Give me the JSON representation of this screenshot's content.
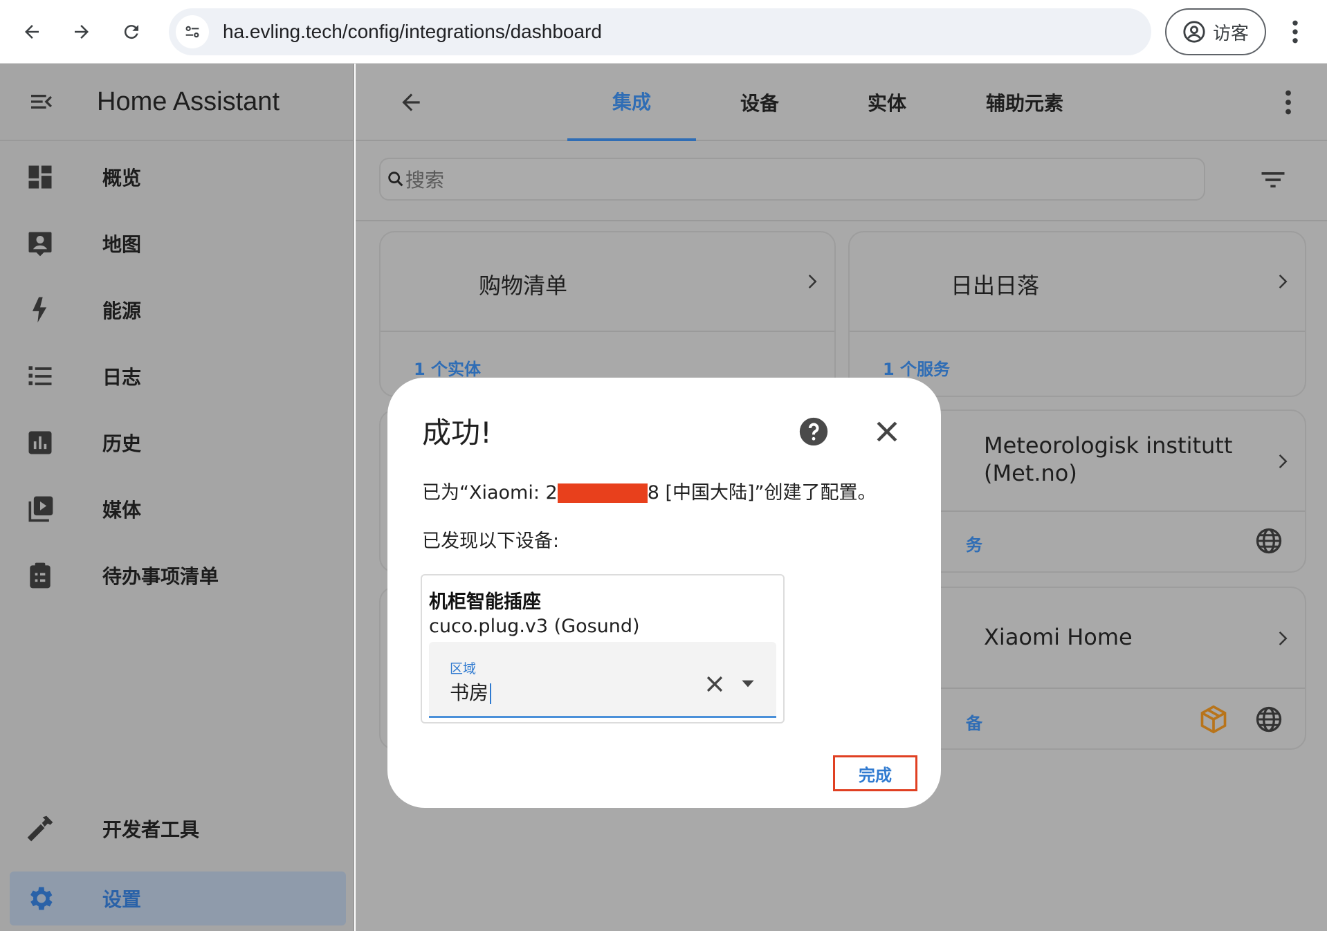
{
  "browser": {
    "url": "ha.evling.tech/config/integrations/dashboard",
    "profile_label": "访客"
  },
  "sidebar": {
    "title": "Home Assistant",
    "items": [
      {
        "label": "概览",
        "icon": "dashboard-icon"
      },
      {
        "label": "地图",
        "icon": "map-icon"
      },
      {
        "label": "能源",
        "icon": "lightning-icon"
      },
      {
        "label": "日志",
        "icon": "logbook-icon"
      },
      {
        "label": "历史",
        "icon": "history-chart-icon"
      },
      {
        "label": "媒体",
        "icon": "media-icon"
      },
      {
        "label": "待办事项清单",
        "icon": "todo-clipboard-icon"
      }
    ],
    "bottom_items": [
      {
        "label": "开发者工具",
        "icon": "hammer-icon"
      },
      {
        "label": "设置",
        "icon": "gear-icon",
        "active": true
      }
    ]
  },
  "topbar": {
    "tabs": [
      "集成",
      "设备",
      "实体",
      "辅助元素"
    ],
    "active_tab": "集成"
  },
  "search": {
    "placeholder": "搜索"
  },
  "cards": [
    {
      "name": "购物清单",
      "footer": "1 个实体"
    },
    {
      "name": "日出日落",
      "footer": "1 个服务"
    },
    {
      "name": "Meteorologisk institutt (Met.no)",
      "footer": "务"
    },
    {
      "name": "Xiaomi Home",
      "footer": "备"
    }
  ],
  "dialog": {
    "title": "成功!",
    "message_prefix": "已为“Xiaomi: 2",
    "message_suffix": "8 [中国大陆]”创建了配置。",
    "discovered_label": "已发现以下设备:",
    "device": {
      "name": "机柜智能插座",
      "model": "cuco.plug.v3 (Gosund)",
      "area_label": "区域",
      "area_value": "书房"
    },
    "done_label": "完成"
  },
  "colors": {
    "accent": "#2f6db5",
    "highlight_border": "#e04022",
    "redaction": "#e8401c"
  }
}
